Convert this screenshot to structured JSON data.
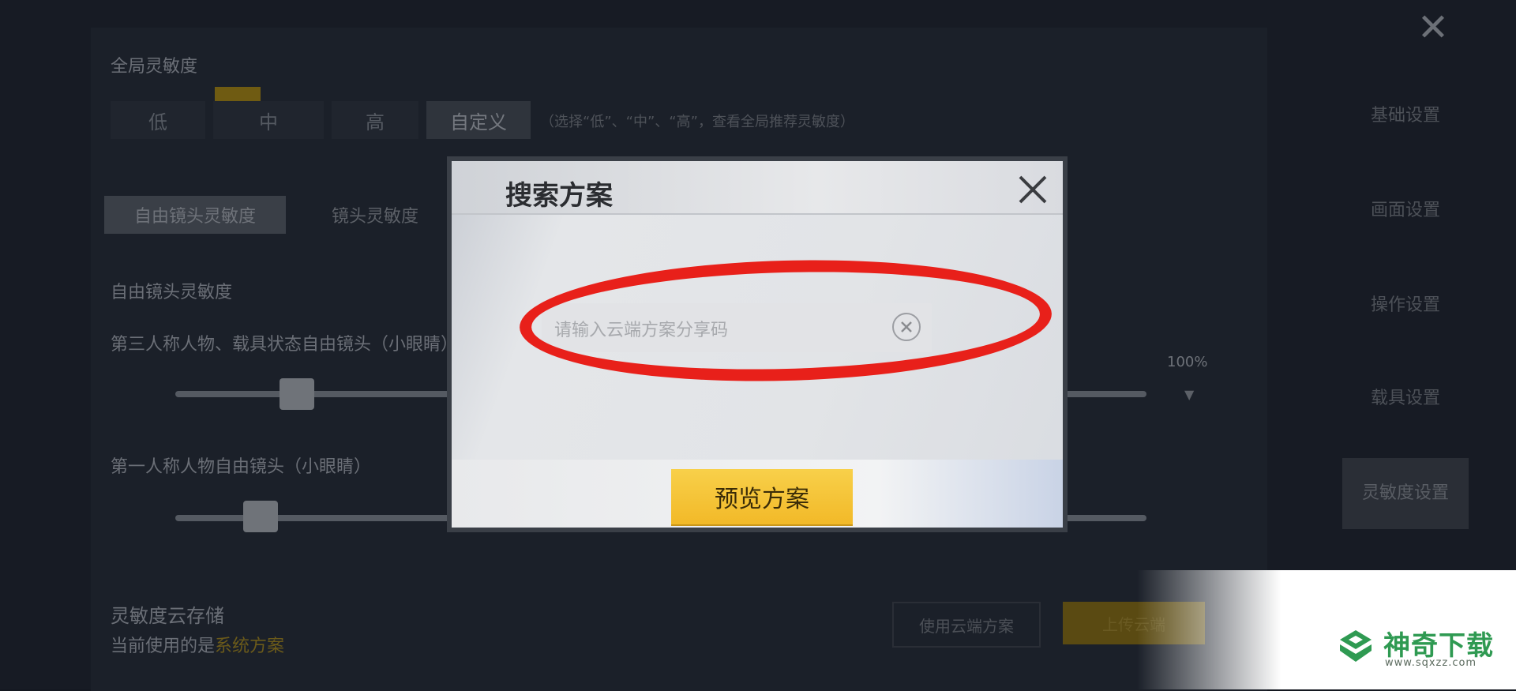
{
  "background": {
    "section_title": "全局灵敏度",
    "levels": [
      {
        "label": "低"
      },
      {
        "label": "中"
      },
      {
        "label": "高"
      },
      {
        "label": "自定义"
      }
    ],
    "levels_hint": "（选择“低”、“中”、“高”，查看全局推荐灵敏度）",
    "subtabs": [
      {
        "label": "自由镜头灵敏度"
      },
      {
        "label": "镜头灵敏度"
      }
    ],
    "group_title": "自由镜头灵敏度",
    "row1_label": "第三人称人物、载具状态自由镜头（小眼睛）",
    "row2_label": "第一人称人物自由镜头（小眼睛）",
    "percent_value": "100%",
    "cloud_title": "灵敏度云存储",
    "cloud_sub": "当前使用的是",
    "cloud_sub_accent": "系统方案",
    "cloud_btn1": "使用云端方案",
    "cloud_btn2": "上传云端",
    "right_nav": [
      {
        "label": "基础设置"
      },
      {
        "label": "画面设置"
      },
      {
        "label": "操作设置"
      },
      {
        "label": "载具设置"
      },
      {
        "label": "灵敏度设置"
      }
    ]
  },
  "modal": {
    "title": "搜索方案",
    "input_placeholder": "请输入云端方案分享码",
    "preview_button": "预览方案"
  },
  "watermark": {
    "brand": "神奇下载",
    "url": "www.sqxzz.com"
  },
  "colors": {
    "highlight_ring": "#e8201a",
    "button_yellow": "#f4c133",
    "watermark_green": "#2f9a52"
  }
}
